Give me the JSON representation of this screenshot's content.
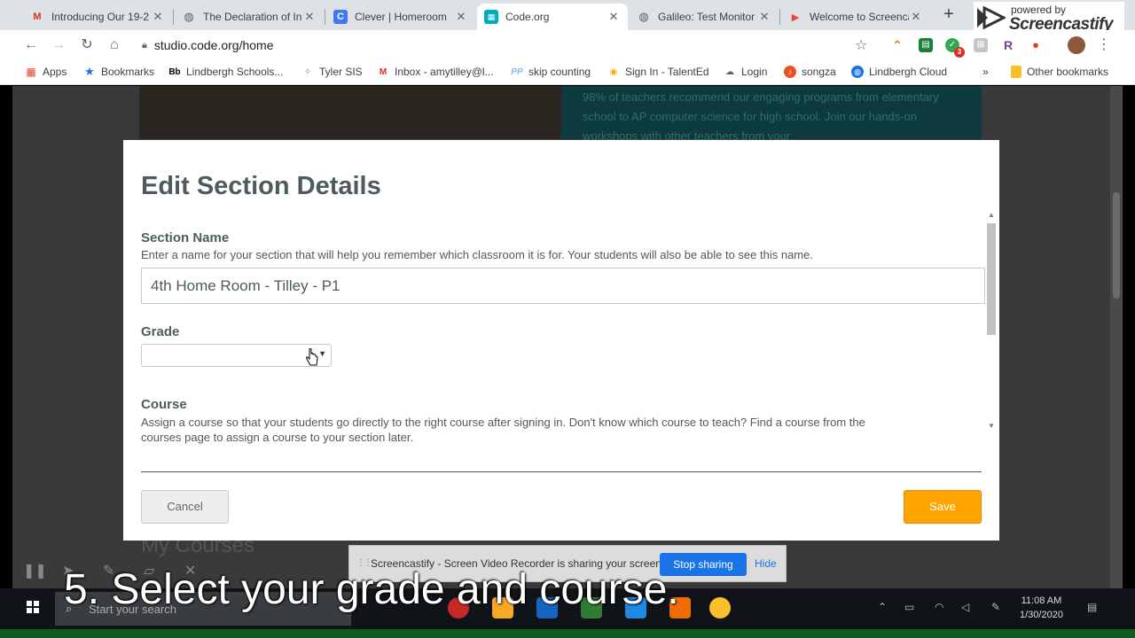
{
  "browser": {
    "tabs": [
      {
        "title": "Introducing Our 19-2",
        "favicon": "gmail-icon"
      },
      {
        "title": "The Declaration of In",
        "favicon": "globe-icon"
      },
      {
        "title": "Clever | Homeroom",
        "favicon": "clever-icon"
      },
      {
        "title": "Code.org",
        "favicon": "codeorg-icon",
        "active": true
      },
      {
        "title": "Galileo: Test Monitor",
        "favicon": "globe-icon"
      },
      {
        "title": "Welcome to Screenca",
        "favicon": "screencastify-icon"
      }
    ],
    "url": "studio.code.org/home",
    "screencastify_powered_by": "powered by",
    "screencastify_name": "Screencastify",
    "ext_badge": "3",
    "bookmarks": [
      {
        "label": "Apps",
        "icon": "apps-grid-icon"
      },
      {
        "label": "Bookmarks",
        "icon": "star-icon"
      },
      {
        "label": "Lindbergh Schools...",
        "icon": "blackboard-icon"
      },
      {
        "label": "Tyler SIS",
        "icon": "tyler-icon"
      },
      {
        "label": "Inbox - amytilley@l...",
        "icon": "gmail-icon"
      },
      {
        "label": "skip counting",
        "icon": "pp-icon"
      },
      {
        "label": "Sign In - TalentEd",
        "icon": "talented-icon"
      },
      {
        "label": "Login",
        "icon": "cloud-icon"
      },
      {
        "label": "songza",
        "icon": "songza-icon"
      },
      {
        "label": "Lindbergh Cloud",
        "icon": "globe-icon"
      },
      {
        "label": "»",
        "icon": ""
      },
      {
        "label": "Other bookmarks",
        "icon": "folder-icon"
      }
    ]
  },
  "page": {
    "hero_text": "98% of teachers recommend our engaging programs from elementary school to AP computer science for high school. Join our hands-on workshops with other teachers from your",
    "my_courses": "My Courses"
  },
  "modal": {
    "title": "Edit Section Details",
    "section_name_label": "Section Name",
    "section_name_desc": "Enter a name for your section that will help you remember which classroom it is for. Your students will also be able to see this name.",
    "section_name_value": "4th Home Room - Tilley - P1",
    "grade_label": "Grade",
    "grade_value": "",
    "course_label": "Course",
    "course_desc_1": "Assign a course so that your students go directly to the right course after signing in. Don't know which course to teach? Find a course from the",
    "course_desc_2": "courses page to assign a course to your section later.",
    "cancel_label": "Cancel",
    "save_label": "Save"
  },
  "share_bar": {
    "message": "Screencastify - Screen Video Recorder is sharing your screen.",
    "stop_label": "Stop sharing",
    "hide_label": "Hide"
  },
  "taskbar": {
    "search_placeholder": "Start your search",
    "time": "11:08 AM",
    "date": "1/30/2020"
  },
  "caption": "5. Select your grade and course.",
  "colors": {
    "save_button": "#ffa400",
    "heading_text": "#4d5b5e",
    "stop_sharing": "#1a73e8"
  }
}
